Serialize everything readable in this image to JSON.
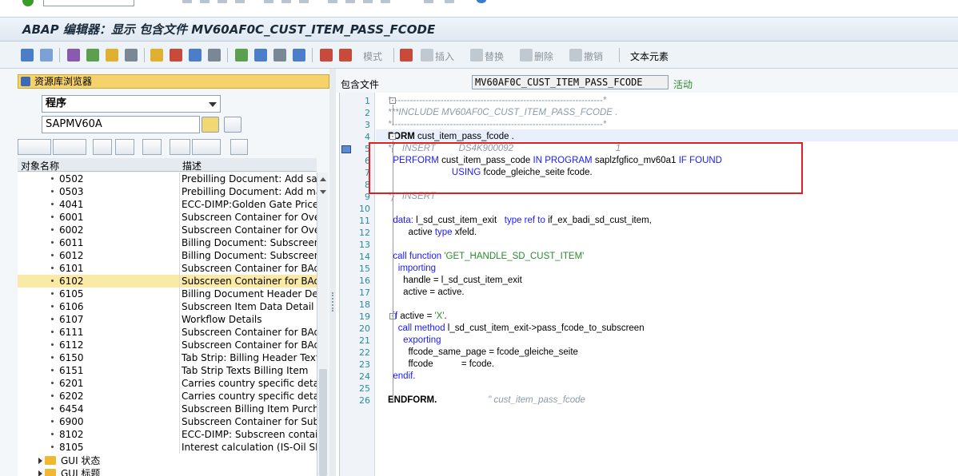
{
  "window": {
    "title": "ABAP 编辑器：显示 包含文件 MV60AF0C_CUST_ITEM_PASS_FCODE"
  },
  "toolbar": {
    "pattern_label": "模式",
    "insert_label": "插入",
    "replace_label": "替换",
    "delete_label": "删除",
    "undo_label": "撤销",
    "text_elements_label": "文本元素"
  },
  "repository_browser": {
    "title": "资源库浏览器",
    "object_type": "程序",
    "object_name": "SAPMV60A",
    "col_object_name": "对象名称",
    "col_description": "描述",
    "rows": [
      {
        "code": "0502",
        "desc": "Prebilling Document: Add sales"
      },
      {
        "code": "0503",
        "desc": "Prebilling Document: Add manu"
      },
      {
        "code": "4041",
        "desc": "ECC-DIMP:Golden Gate Price Pr"
      },
      {
        "code": "6001",
        "desc": "Subscreen Container for Overvi"
      },
      {
        "code": "6002",
        "desc": "Subscreen Container for Overvi"
      },
      {
        "code": "6011",
        "desc": "Billing Document: Subscreen, G"
      },
      {
        "code": "6012",
        "desc": "Billing Document: Subscreen, G"
      },
      {
        "code": "6101",
        "desc": "Subscreen Container for BAdI L"
      },
      {
        "code": "6102",
        "desc": "Subscreen Container for BAdI L"
      },
      {
        "code": "6105",
        "desc": "Billing Document Header Detail"
      },
      {
        "code": "6106",
        "desc": "Subscreen Item Data Detail"
      },
      {
        "code": "6107",
        "desc": "Workflow Details"
      },
      {
        "code": "6111",
        "desc": "Subscreen Container for BAdI L"
      },
      {
        "code": "6112",
        "desc": "Subscreen Container for BAdI L"
      },
      {
        "code": "6150",
        "desc": "Tab Strip: Billing Header Texts"
      },
      {
        "code": "6151",
        "desc": "Tab Strip Texts Billing Item"
      },
      {
        "code": "6201",
        "desc": "Carries country specific detail sc"
      },
      {
        "code": "6202",
        "desc": "Carries country specific detail sc"
      },
      {
        "code": "6454",
        "desc": "Subscreen Billing Item Purchasin"
      },
      {
        "code": "6900",
        "desc": "Subscreen Container for Subscr"
      },
      {
        "code": "8102",
        "desc": "ECC-DIMP: Subscreen container"
      },
      {
        "code": "8105",
        "desc": "Interest calculation (IS-Oil SDP"
      }
    ],
    "selected_code": "6102",
    "folders": [
      "GUI 状态",
      "GUI 标题"
    ]
  },
  "editor": {
    "include_label": "包含文件",
    "include_name": "MV60AF0C_CUST_ITEM_PASS_FCODE",
    "status": "活动",
    "lines": [
      "*---------------------------------------------------------------------*",
      "***INCLUDE MV60AF0C_CUST_ITEM_PASS_FCODE .",
      "*---------------------------------------------------------------------*",
      "FORM cust_item_pass_fcode .",
      "*{   INSERT         DS4K900092                                        1",
      "  PERFORM cust_item_pass_code IN PROGRAM saplzfgfico_mv60a1 IF FOUND",
      "                         USING fcode_gleiche_seite fcode.",
      "",
      "*}   INSERT",
      "",
      "  data: l_sd_cust_item_exit   type ref to if_ex_badi_sd_cust_item,",
      "        active type xfeld.",
      "",
      "  call function 'GET_HANDLE_SD_CUST_ITEM'",
      "    importing",
      "      handle = l_sd_cust_item_exit",
      "      active = active.",
      "",
      "  if active = 'X'.",
      "    call method l_sd_cust_item_exit->pass_fcode_to_subscreen",
      "      exporting",
      "        ffcode_same_page = fcode_gleiche_seite",
      "        ffcode           = fcode.",
      "  endif.",
      "",
      "ENDFORM.                    \" cust_item_pass_fcode"
    ]
  }
}
